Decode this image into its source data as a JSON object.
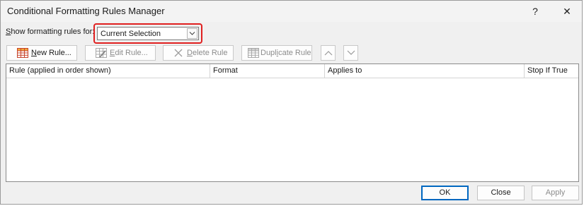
{
  "window": {
    "title": "Conditional Formatting Rules Manager",
    "help_glyph": "?",
    "close_glyph": "✕"
  },
  "show_rules": {
    "label_prefix": "S",
    "label_rest": "how formatting rules for:",
    "selected": "Current Selection"
  },
  "toolbar": {
    "new_rule": {
      "mnemonic": "N",
      "rest": "ew Rule...",
      "icon": "grid-table-icon",
      "enabled": true
    },
    "edit_rule": {
      "mnemonic": "E",
      "rest": "dit Rule...",
      "icon": "edit-grid-icon",
      "enabled": false
    },
    "delete_rule": {
      "mnemonic": "D",
      "rest": "elete Rule",
      "icon": "x-icon",
      "enabled": false
    },
    "duplicate_rule": {
      "pre": "Dupl",
      "mnemonic": "i",
      "rest": "cate Rule",
      "icon": "grid-table-icon",
      "enabled": false
    },
    "move_up": {
      "icon": "chevron-up-icon",
      "enabled": false
    },
    "move_down": {
      "icon": "chevron-down-icon",
      "enabled": false
    }
  },
  "rules_table": {
    "columns": [
      "Rule (applied in order shown)",
      "Format",
      "Applies to",
      "Stop If True"
    ],
    "rows": []
  },
  "footer": {
    "ok": "OK",
    "close": "Close",
    "apply": "Apply"
  },
  "colors": {
    "highlight": "#e02020",
    "default_button_border": "#0067c0",
    "disabled_text": "#8c8c8c"
  }
}
